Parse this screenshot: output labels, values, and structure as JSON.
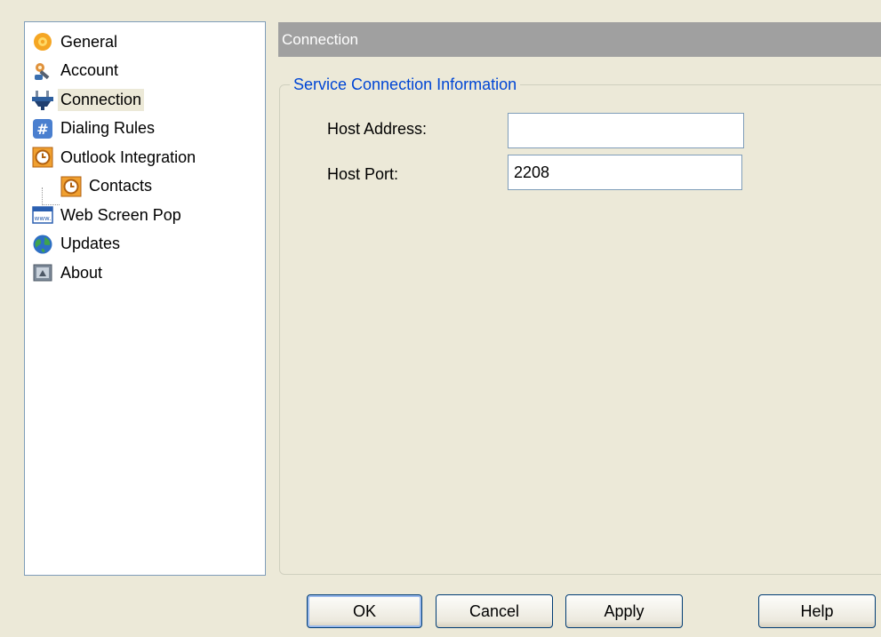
{
  "sidebar": {
    "items": [
      {
        "label": "General",
        "icon": "sun-gear-icon"
      },
      {
        "label": "Account",
        "icon": "user-key-icon"
      },
      {
        "label": "Connection",
        "icon": "plug-icon",
        "selected": true
      },
      {
        "label": "Dialing Rules",
        "icon": "hash-icon"
      },
      {
        "label": "Outlook Integration",
        "icon": "clock-icon"
      },
      {
        "label": "Contacts",
        "icon": "clock-icon",
        "child": true
      },
      {
        "label": "Web Screen Pop",
        "icon": "www-icon"
      },
      {
        "label": "Updates",
        "icon": "globe-icon"
      },
      {
        "label": "About",
        "icon": "about-icon"
      }
    ]
  },
  "panel": {
    "title": "Connection",
    "group_title": "Service Connection Information",
    "host_address_label": "Host Address:",
    "host_address_value": "",
    "host_port_label": "Host Port:",
    "host_port_value": "2208"
  },
  "buttons": {
    "ok": "OK",
    "cancel": "Cancel",
    "apply": "Apply",
    "help": "Help"
  },
  "colors": {
    "window_bg": "#ece9d8",
    "header_bg": "#a0a0a0",
    "group_title": "#0046d5",
    "button_border": "#003c74"
  }
}
